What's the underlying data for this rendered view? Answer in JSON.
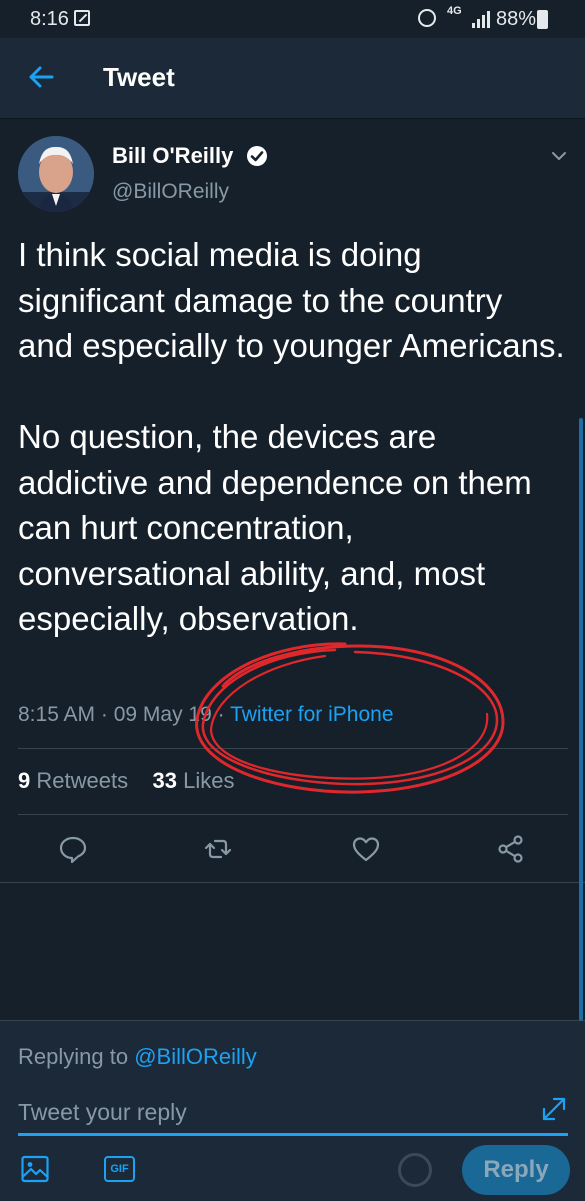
{
  "status_bar": {
    "time": "8:16",
    "network": "4G",
    "battery": "88%",
    "icons": [
      "notification-icon",
      "alarm-icon",
      "signal-icon",
      "battery-icon"
    ]
  },
  "header": {
    "title": "Tweet",
    "back_icon": "arrow-left-icon"
  },
  "tweet": {
    "author_name": "Bill O'Reilly",
    "author_handle": "@BillOReilly",
    "verified": true,
    "text_p1": "I think social media is doing significant damage to the country and especially to younger Americans.",
    "text_p2": "No question, the devices are addictive and dependence on them can hurt concentration, conversational ability, and, most especially, observation.",
    "time": "8:15 AM",
    "separator": " · ",
    "date": "09 May 19",
    "source": "Twitter for iPhone",
    "retweet_count": "9",
    "retweet_label": "Retweets",
    "like_count": "33",
    "like_label": "Likes"
  },
  "actions": [
    "comment-icon",
    "retweet-icon",
    "like-icon",
    "share-icon"
  ],
  "reply": {
    "replying_label": "Replying to",
    "replying_handle": "@BillOReilly",
    "placeholder": "Tweet your reply",
    "gif_label": "GIF",
    "button_label": "Reply"
  },
  "colors": {
    "background": "#15202b",
    "bar": "#1c2938",
    "accent": "#1da1f2",
    "muted": "#8899a6",
    "annotation": "#e0282c"
  }
}
